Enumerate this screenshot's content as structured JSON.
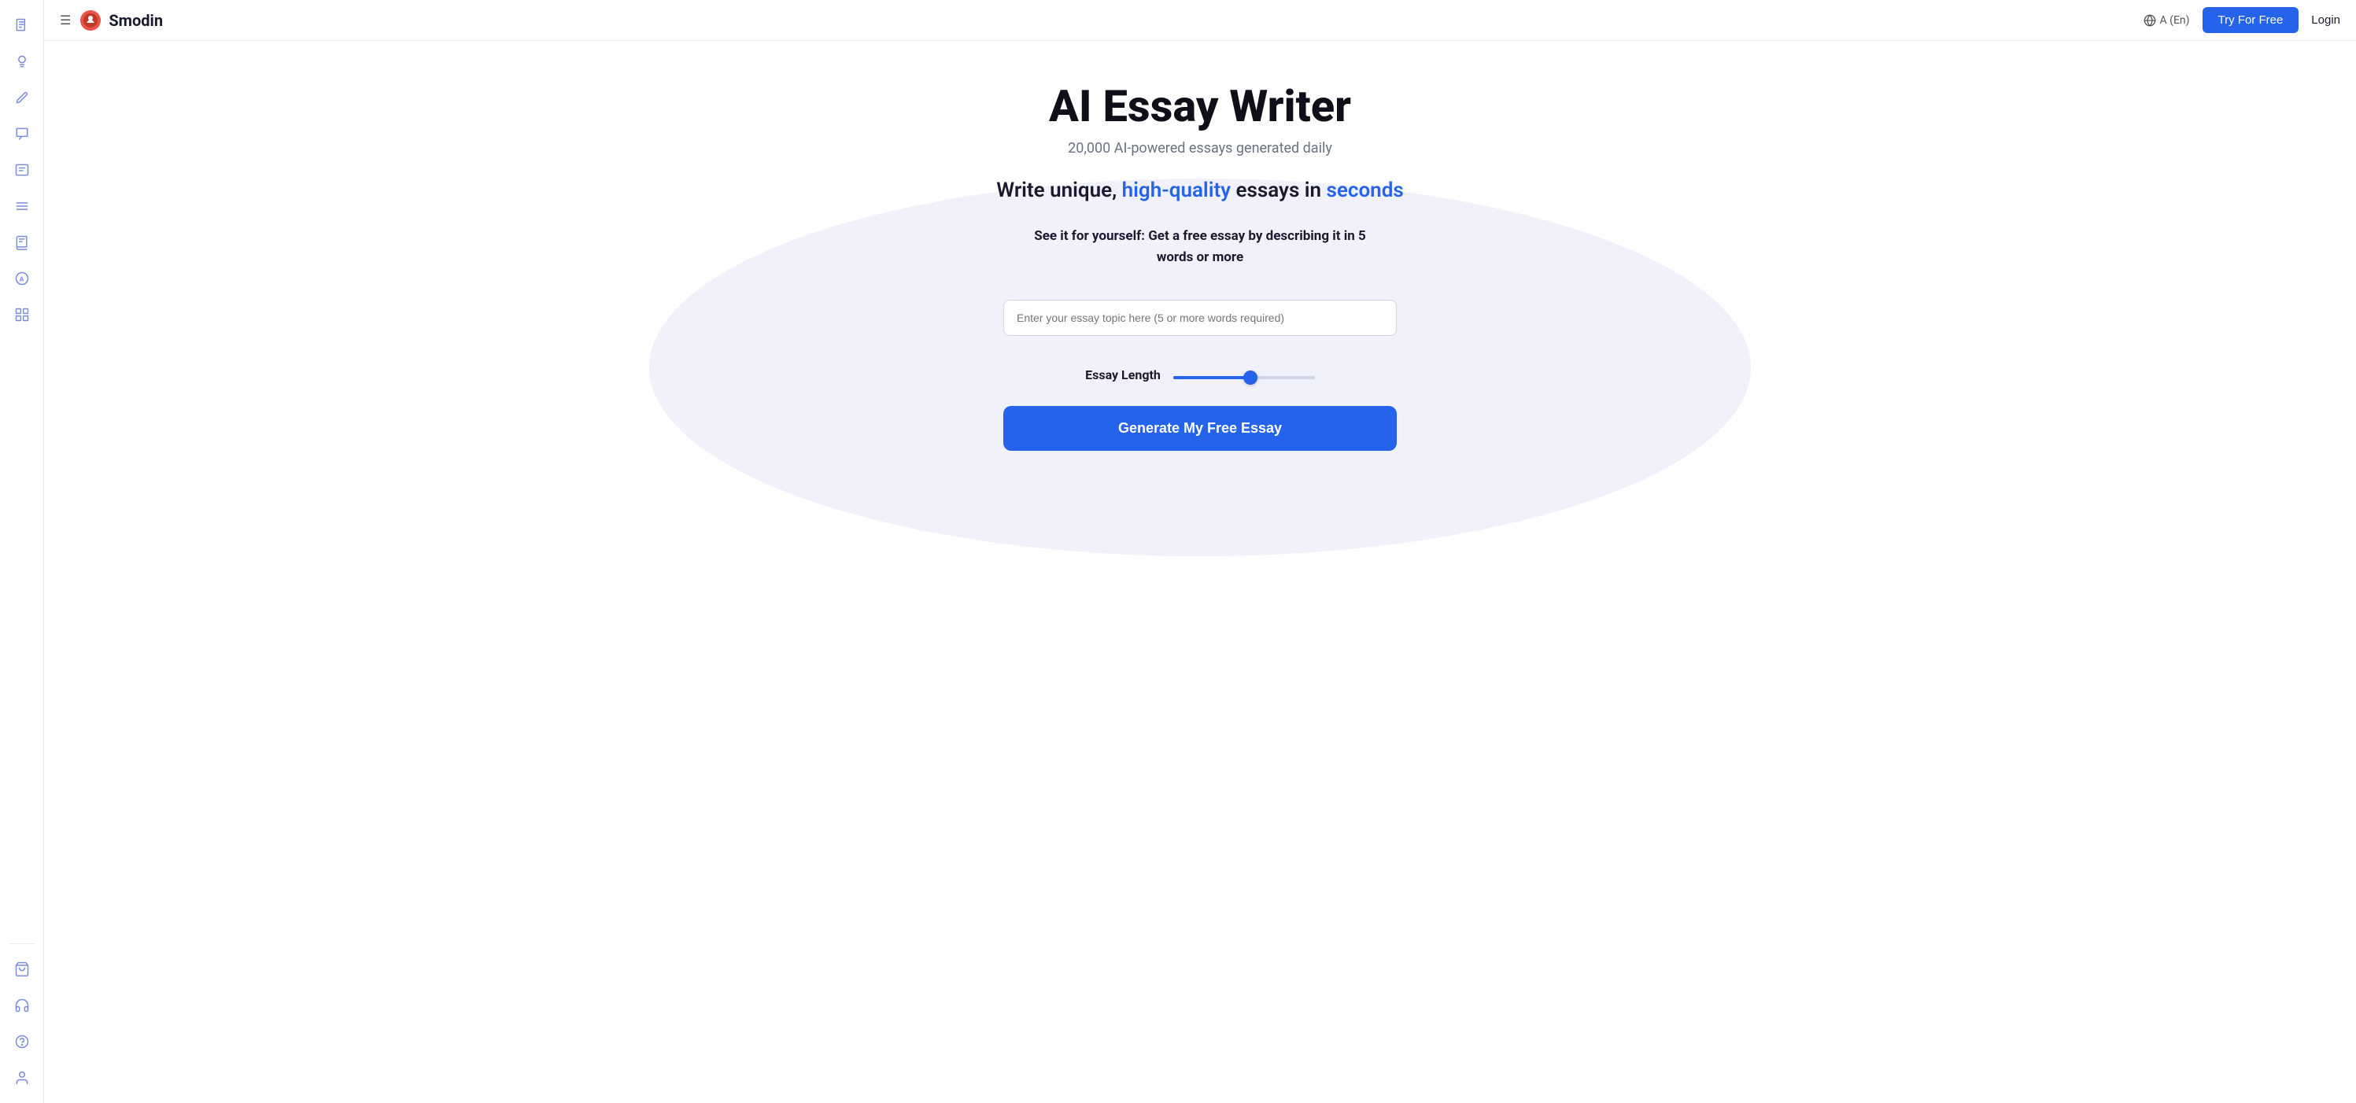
{
  "brand": {
    "name": "Smodin",
    "logo_alt": "Smodin logo"
  },
  "nav": {
    "language": "A (En)",
    "try_free_label": "Try For Free",
    "login_label": "Login"
  },
  "hero": {
    "title": "AI Essay Writer",
    "subtitle": "20,000 AI-powered essays generated daily",
    "tagline_prefix": "Write unique, ",
    "tagline_highlight1": "high-quality",
    "tagline_middle": " essays in ",
    "tagline_highlight2": "seconds"
  },
  "cta": {
    "see_it_text": "See it for yourself: Get a free essay by describing it in 5\nwords or more",
    "input_placeholder": "Enter your essay topic here (5 or more words required)",
    "essay_length_label": "Essay Length",
    "generate_btn_label": "Generate My Free Essay",
    "slider_value": 55
  },
  "sidebar": {
    "icons": [
      {
        "name": "document-icon",
        "symbol": "📄"
      },
      {
        "name": "lightbulb-icon",
        "symbol": "💡"
      },
      {
        "name": "edit-icon",
        "symbol": "✏️"
      },
      {
        "name": "chat-icon",
        "symbol": "💬"
      },
      {
        "name": "feedback-icon",
        "symbol": "📣"
      },
      {
        "name": "list-icon",
        "symbol": "≡"
      },
      {
        "name": "book-icon",
        "symbol": "📚"
      },
      {
        "name": "circle-a-icon",
        "symbol": "Ⓐ"
      },
      {
        "name": "apps-icon",
        "symbol": "⊞"
      }
    ],
    "bottom_icons": [
      {
        "name": "cart-icon",
        "symbol": "🛒"
      },
      {
        "name": "headset-icon",
        "symbol": "🎧"
      },
      {
        "name": "help-icon",
        "symbol": "?"
      },
      {
        "name": "user-icon",
        "symbol": "👤"
      }
    ]
  },
  "colors": {
    "accent": "#2563eb",
    "brand_text": "#1a1a2e",
    "muted": "#6b7280",
    "highlight": "#2563eb",
    "sidebar_icon": "#7b8cde",
    "blob": "#e8eaf8"
  }
}
